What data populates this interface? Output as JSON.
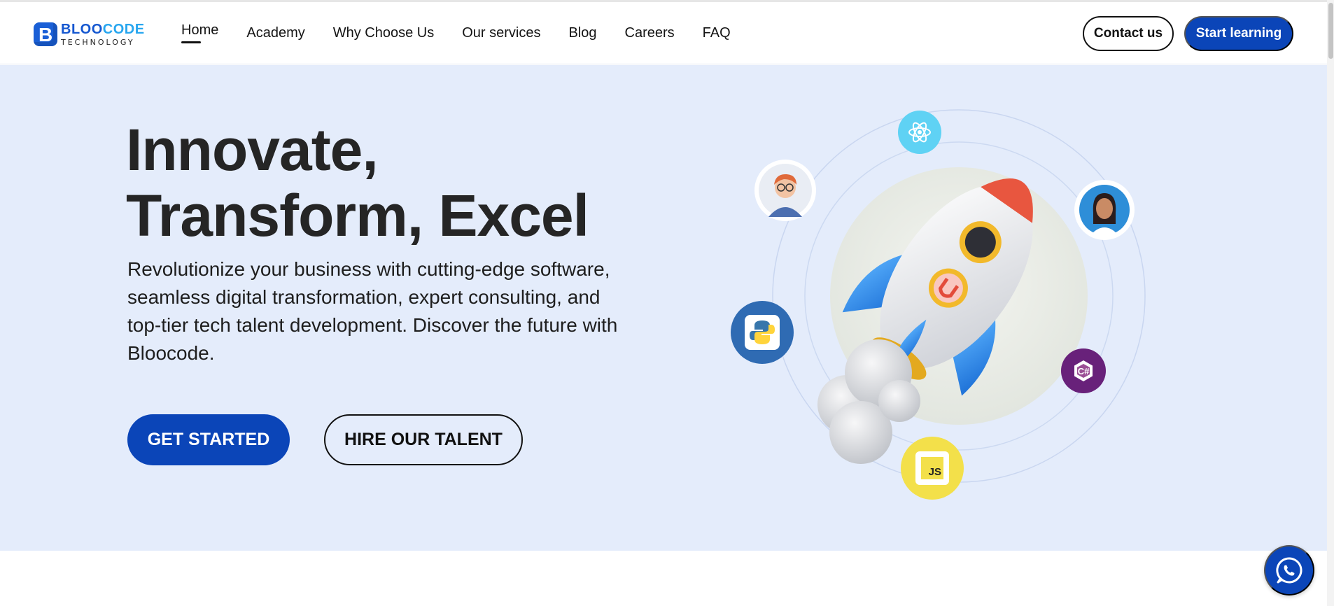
{
  "brand": {
    "name_part1": "BLOO",
    "name_part2": "CODE",
    "tagline": "TECHNOLOGY",
    "primary_color": "#0b45b8",
    "accent_color": "#27a6ef"
  },
  "nav": {
    "items": [
      {
        "label": "Home",
        "active": true
      },
      {
        "label": "Academy"
      },
      {
        "label": "Why Choose Us"
      },
      {
        "label": "Our services"
      },
      {
        "label": "Blog"
      },
      {
        "label": "Careers"
      },
      {
        "label": "FAQ"
      }
    ],
    "contact_label": "Contact us",
    "start_label": "Start learning"
  },
  "hero": {
    "title_line1": "Innovate,",
    "title_line2": "Transform, Excel",
    "description": "Revolutionize your business with cutting-edge software, seamless digital transformation, expert consulting, and top-tier tech talent development. Discover the future with Bloocode.",
    "primary_cta": "GET STARTED",
    "secondary_cta": "HIRE OUR TALENT",
    "background_color": "#e4ecfb",
    "badges": {
      "js_label": "JS",
      "csharp_label": "C#"
    }
  },
  "icons": {
    "react": "react-icon",
    "python": "python-icon",
    "javascript": "javascript-icon",
    "csharp": "csharp-icon",
    "whatsapp": "whatsapp-icon"
  }
}
